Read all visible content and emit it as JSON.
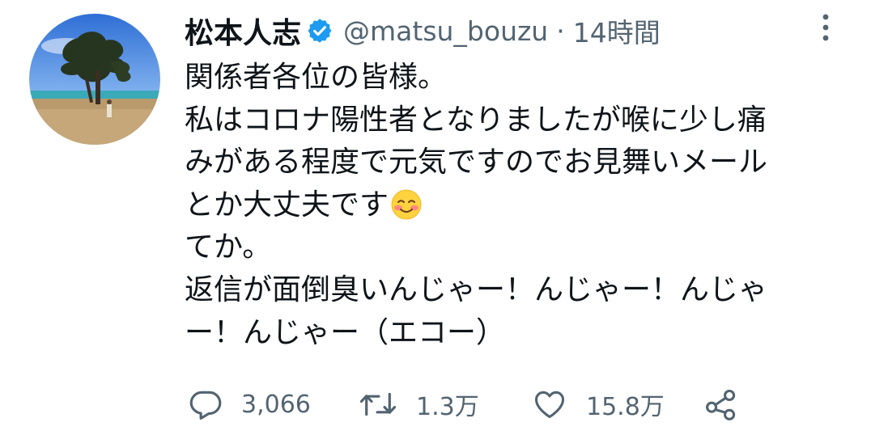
{
  "user": {
    "name": "松本人志",
    "handle": "@matsu_bouzu",
    "separator": "·",
    "time": "14時間",
    "verified_color": "#1d9bf0"
  },
  "tweet": {
    "lines": [
      "関係者各位の皆様。",
      "私はコロナ陽性者となりましたが喉に少し痛",
      "みがある程度で元気ですのでお見舞いメール",
      "とか大丈夫です",
      "てか。",
      "返信が面倒臭いんじゃー！んじゃー！んじゃ",
      "ー！んじゃー（エコー）"
    ],
    "emoji": "smiling-face-with-blushing-cheeks"
  },
  "actions": {
    "reply_count": "3,066",
    "retweet_count": "1.3万",
    "like_count": "15.8万"
  },
  "icons": {
    "reply": "reply-icon",
    "retweet": "retweet-icon",
    "like": "like-icon",
    "share": "share-icon",
    "more": "more-icon"
  }
}
